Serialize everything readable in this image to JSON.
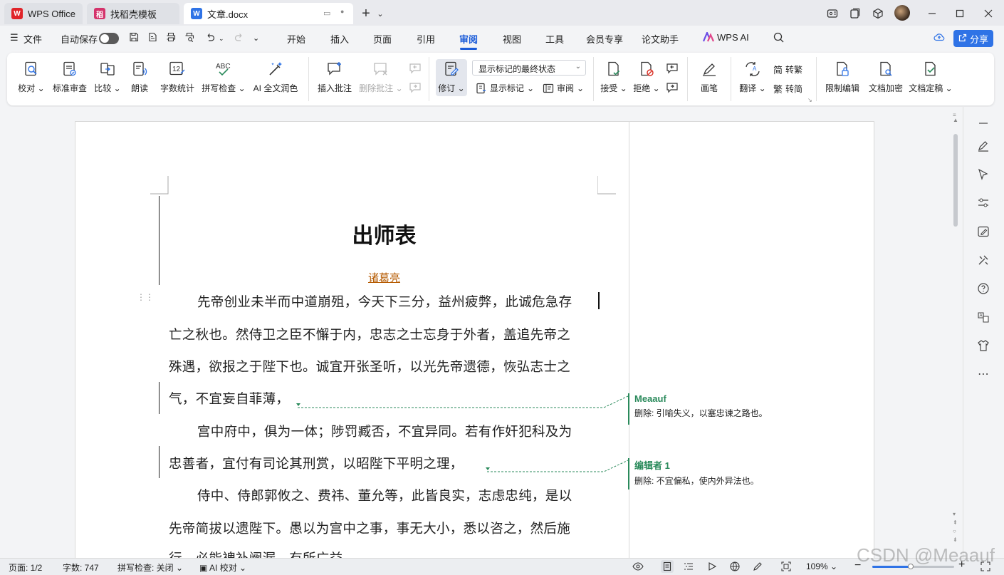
{
  "tabs": [
    {
      "label": "WPS Office",
      "color": "#e0242a"
    },
    {
      "label": "找稻壳模板",
      "color": "#d4336b"
    },
    {
      "label": "文章.docx",
      "color": "#2f73e6"
    }
  ],
  "menubar": {
    "file": "文件",
    "autosave": "自动保存",
    "items": [
      "开始",
      "插入",
      "页面",
      "引用",
      "审阅",
      "视图",
      "工具",
      "会员专享",
      "论文助手",
      "WPS AI"
    ],
    "active": "审阅",
    "share": "分享"
  },
  "ribbon": {
    "proofread": "校对",
    "standard_review": "标准审查",
    "compare": "比较",
    "read_aloud": "朗读",
    "word_count": "字数统计",
    "spell_check": "拼写检查",
    "ai_polish": "AI 全文润色",
    "insert_comment": "插入批注",
    "delete_comment": "删除批注",
    "track_changes": "修订",
    "display_combo": "显示标记的最终状态",
    "show_markup": "显示标记",
    "review": "审阅",
    "accept": "接受",
    "reject": "拒绝",
    "pen": "画笔",
    "translate": "翻译",
    "to_traditional": "转繁",
    "to_simplified": "转简",
    "restrict_edit": "限制编辑",
    "encrypt": "文档加密",
    "finalize": "文档定稿",
    "abc": "ABC",
    "num12": "12"
  },
  "document": {
    "title": "出师表",
    "author": "诸葛亮",
    "lines": [
      "先帝创业未半而中道崩殂，今天下三分，益州疲弊，此诚危急存",
      "亡之秋也。然侍卫之臣不懈于内，忠志之士忘身于外者，盖追先帝之",
      "殊遇，欲报之于陛下也。诚宜开张圣听，以光先帝遗德，恢弘志士之",
      "气，不宜妄自菲薄，",
      "宫中府中，俱为一体；陟罚臧否，不宜异同。若有作奸犯科及为",
      "忠善者，宜付有司论其刑赏，以昭陛下平明之理，",
      "侍中、侍郎郭攸之、费祎、董允等，此皆良实，志虑忠纯，是以",
      "先帝简拔以遗陛下。愚以为宫中之事，事无大小，悉以咨之，然后施",
      "行，必能裨补阙漏，有所广益。"
    ]
  },
  "comments": [
    {
      "author": "Meaauf",
      "text": "删除: 引喻失义，以塞忠谏之路也。"
    },
    {
      "author": "编辑者 1",
      "text": "删除: 不宜偏私，使内外异法也。"
    }
  ],
  "status": {
    "page": "页面: 1/2",
    "words": "字数: 747",
    "spell": "拼写检查: 关闭",
    "ai_check": "AI 校对",
    "zoom": "109%",
    "zoom_fraction": 0.46
  },
  "watermark": "CSDN @Meaauf",
  "colors": {
    "accent": "#1a5bd8",
    "comment": "#2a8a5b",
    "author": "#b55a00"
  }
}
